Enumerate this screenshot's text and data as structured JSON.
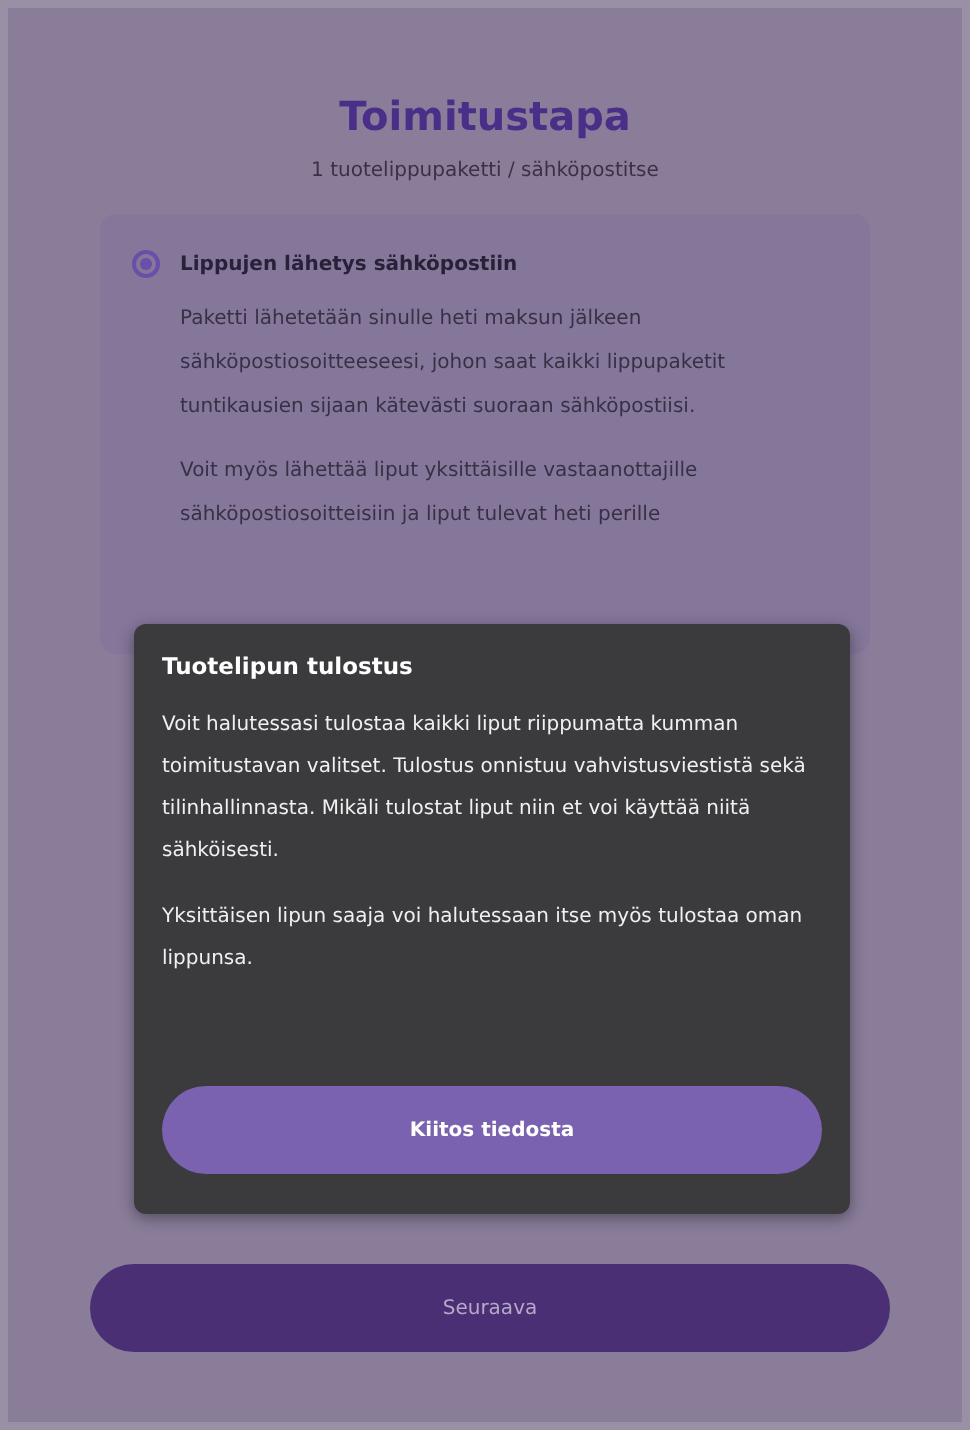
{
  "page": {
    "title": "Toimitustapa",
    "subtitle": "1 tuotelippupaketti / sähköpostitse"
  },
  "options": [
    {
      "label": "Lippujen lähetys sähköpostiin",
      "selected": true,
      "paragraphs": [
        "Paketti lähetetään sinulle heti maksun jälkeen sähköpostiosoitteeseesi, johon saat kaikki lippupaketit tuntikausien sijaan kätevästi suoraan sähköpostiisi.",
        "Voit myös lähettää liput yksittäisille vastaanottajille sähköpostiosoitteisiin ja liput tulevat heti perille"
      ]
    }
  ],
  "modal": {
    "title": "Tuotelipun tulostus",
    "paragraphs": [
      "Voit halutessasi tulostaa kaikki liput riippumatta kumman toimitustavan valitset. Tulostus onnistuu vahvistusviestistä sekä tilinhallinnasta. Mikäli tulostat liput niin et voi käyttää niitä sähköisesti.",
      "Yksittäisen lipun saaja voi halutessaan itse myös tulostaa oman lippunsa."
    ],
    "button": "Kiitos tiedosta"
  },
  "footer_button": "Seuraava"
}
